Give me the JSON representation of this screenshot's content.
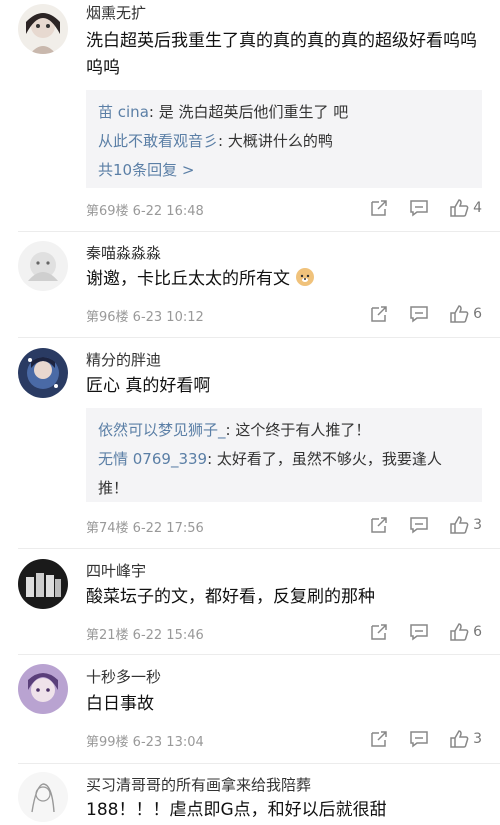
{
  "comments": [
    {
      "username": "烟熏无扩",
      "content": "洗白超英后我重生了真的真的真的真的超级好看呜呜呜呜",
      "replies": [
        {
          "user": "苗 cina",
          "text": "是 洗白超英后他们重生了 吧"
        },
        {
          "user": "从此不敢看观音彡",
          "text": "大概讲什么的鸭"
        }
      ],
      "more_replies": "共10条回复 >",
      "floor_time": "第69楼  6-22 16:48",
      "likes": "4"
    },
    {
      "username": "秦喵淼淼淼",
      "content": "谢邀，卡比丘太太的所有文",
      "floor_time": "第96楼  6-23 10:12",
      "likes": "6"
    },
    {
      "username": "精分的胖迪",
      "content": "匠心 真的好看啊",
      "replies": [
        {
          "user": "依然可以梦见狮子_",
          "text": "这个终于有人推了！"
        },
        {
          "user": "无情 0769_339",
          "text": "太好看了，虽然不够火，我要逢人推！"
        }
      ],
      "floor_time": "第74楼  6-22 17:56",
      "likes": "3"
    },
    {
      "username": "四叶峰宇",
      "content": "酸菜坛子的文，都好看，反复刷的那种",
      "floor_time": "第21楼  6-22 15:46",
      "likes": "6"
    },
    {
      "username": "十秒多一秒",
      "content": "白日事故",
      "floor_time": "第99楼  6-23 13:04",
      "likes": "3"
    },
    {
      "username": "买习清哥哥的所有画拿来给我陪葬",
      "content": "188！！！虐点即G点，和好以后就很甜"
    }
  ],
  "icons": {
    "share": "share-icon",
    "comment": "comment-icon",
    "like": "thumbs-up-icon",
    "emoji": "doge-emoji-icon"
  },
  "colors": {
    "link": "#5b7fa6",
    "reply_bg": "#f4f4f6",
    "meta": "#999999"
  }
}
